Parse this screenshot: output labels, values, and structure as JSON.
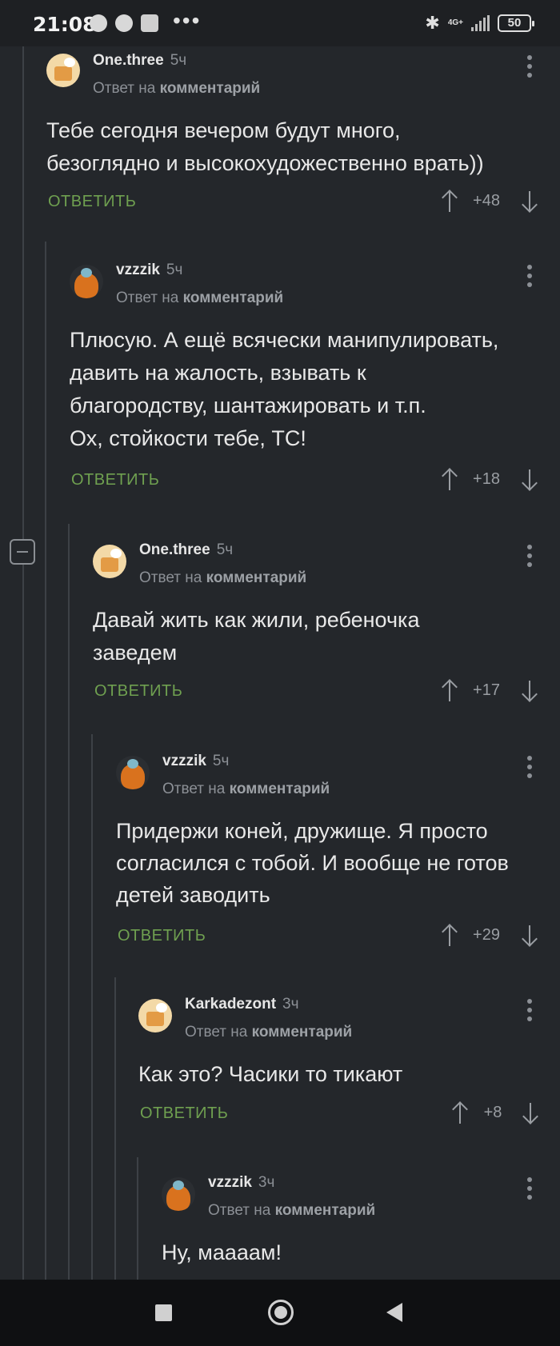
{
  "status_bar": {
    "time": "21:08",
    "left_icons": [
      "sync-icon",
      "app-icon",
      "tiktok-icon"
    ],
    "overflow": "•••",
    "bluetooth": "bluetooth-icon",
    "network": "4G+",
    "battery": "50"
  },
  "comments": [
    {
      "author": "One.three",
      "time": "5ч",
      "reply_prefix": "Ответ на",
      "reply_target": "комментарий",
      "lines": [
        "Тебе сегодня вечером будут много,",
        "безоглядно и высокохудожественно врать))"
      ],
      "answer": "ОТВЕТИТЬ",
      "score": "+48"
    },
    {
      "author": "vzzzik",
      "time": "5ч",
      "reply_prefix": "Ответ на",
      "reply_target": "комментарий",
      "lines": [
        "Плюсую. А ещё всячески манипулировать,",
        "давить на жалость, взывать к",
        "благородству, шантажировать и т.п.",
        "Ох, стойкости тебе, ТС!"
      ],
      "answer": "ОТВЕТИТЬ",
      "score": "+18"
    },
    {
      "author": "One.three",
      "time": "5ч",
      "reply_prefix": "Ответ на",
      "reply_target": "комментарий",
      "lines": [
        "Давай жить как жили, ребеночка",
        "заведем"
      ],
      "answer": "ОТВЕТИТЬ",
      "score": "+17"
    },
    {
      "author": "vzzzik",
      "time": "5ч",
      "reply_prefix": "Ответ на",
      "reply_target": "комментарий",
      "lines": [
        "Придержи коней, дружище. Я просто",
        "согласился с тобой. И вообще не готов",
        "детей заводить"
      ],
      "answer": "ОТВЕТИТЬ",
      "score": "+29"
    },
    {
      "author": "Karkadezont",
      "time": "3ч",
      "reply_prefix": "Ответ на",
      "reply_target": "комментарий",
      "lines": [
        "Как это? Часики то тикают"
      ],
      "answer": "ОТВЕТИТЬ",
      "score": "+8"
    },
    {
      "author": "vzzzik",
      "time": "3ч",
      "reply_prefix": "Ответ на",
      "reply_target": "комментарий",
      "lines": [
        "Ну, маааам!"
      ]
    }
  ],
  "nav_bar": {
    "recent": "recent-apps-icon",
    "home": "home-icon",
    "back": "back-icon"
  },
  "colors": {
    "background": "#24272b",
    "accent_green": "#6fa050",
    "muted": "#8c9096"
  }
}
